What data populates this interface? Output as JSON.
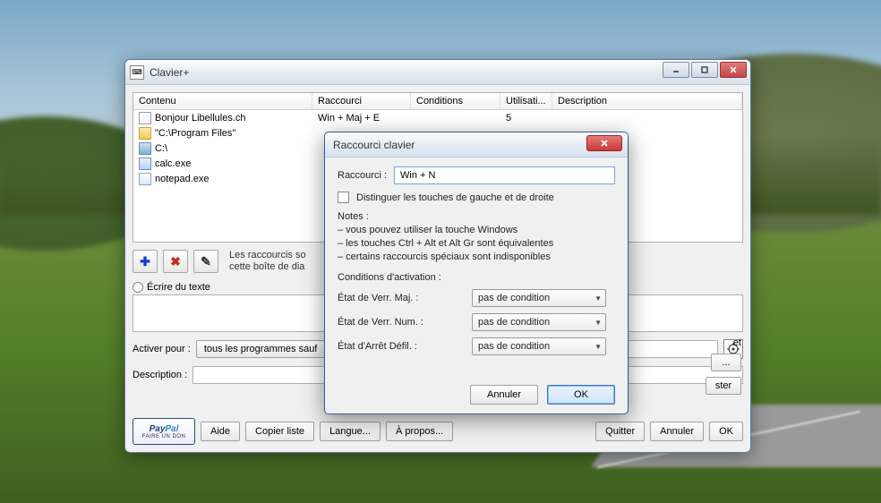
{
  "main": {
    "title": "Clavier+",
    "columns": {
      "contenu": "Contenu",
      "raccourci": "Raccourci",
      "conditions": "Conditions",
      "utilisation": "Utilisati...",
      "description": "Description"
    },
    "rows": [
      {
        "icon": "script",
        "contenu": "Bonjour Libellules.ch",
        "raccourci": "Win + Maj + E",
        "conditions": "",
        "util": "5",
        "desc": ""
      },
      {
        "icon": "folder",
        "contenu": "\"C:\\Program Files\"",
        "raccourci": "",
        "conditions": "",
        "util": "",
        "desc": ""
      },
      {
        "icon": "drive",
        "contenu": "C:\\",
        "raccourci": "",
        "conditions": "",
        "util": "",
        "desc": ""
      },
      {
        "icon": "calc",
        "contenu": "calc.exe",
        "raccourci": "",
        "conditions": "",
        "util": "",
        "desc": ""
      },
      {
        "icon": "notepad",
        "contenu": "notepad.exe",
        "raccourci": "",
        "conditions": "",
        "util": "",
        "desc": ""
      }
    ],
    "hint_line1": "Les raccourcis so",
    "hint_line2": "cette boîte de dia",
    "radio_ecrire": "Écrire du texte",
    "activer_pour_label": "Activer pour :",
    "activer_pour_value": "tous les programmes sauf",
    "description_label": "Description :",
    "right_fragment_net": "et",
    "right_button_dots": "...",
    "right_fragment_ster": "ster",
    "paypal_label": "PayPal",
    "paypal_sub": "FAIRE UN DON",
    "buttons": {
      "aide": "Aide",
      "copier": "Copier liste",
      "langue": "Langue...",
      "apropos": "À propos...",
      "quitter": "Quitter",
      "annuler": "Annuler",
      "ok": "OK"
    }
  },
  "dialog": {
    "title": "Raccourci clavier",
    "raccourci_label": "Raccourci :",
    "raccourci_value": "Win + N",
    "distinguer": "Distinguer les touches de gauche et de droite",
    "notes_title": "Notes :",
    "note1": "– vous pouvez utiliser la touche Windows",
    "note2": "– les touches Ctrl + Alt et Alt Gr sont équivalentes",
    "note3": "– certains raccourcis spéciaux sont indisponibles",
    "cond_title": "Conditions d'activation :",
    "cond_caps": "État de Verr. Maj. :",
    "cond_num": "État de Verr. Num. :",
    "cond_scroll": "État d'Arrêt Défil. :",
    "combo_value": "pas de condition",
    "annuler": "Annuler",
    "ok": "OK"
  }
}
